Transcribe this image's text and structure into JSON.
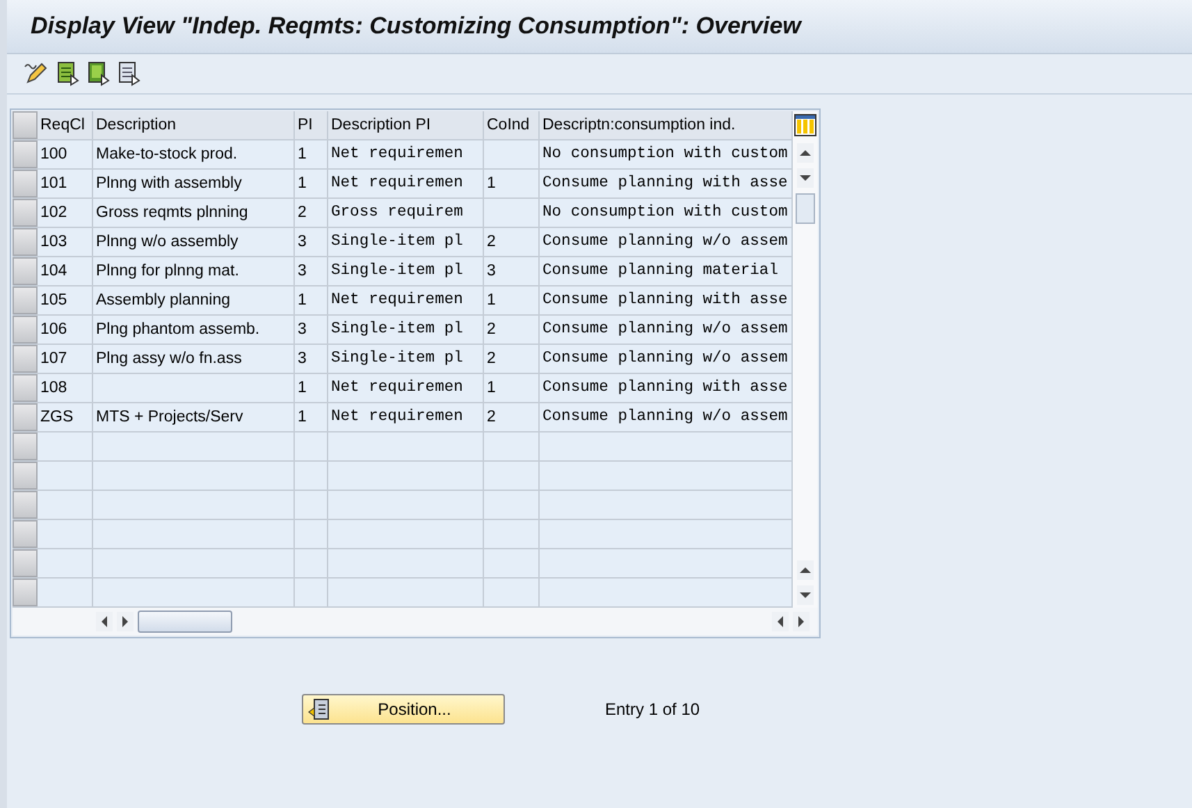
{
  "window": {
    "title": "Display View \"Indep. Reqmts: Customizing Consumption\": Overview"
  },
  "table": {
    "columns": [
      "ReqCl",
      "Description",
      "PI",
      "Description PI",
      "CoInd",
      "Descriptn:consumption ind."
    ],
    "rows": [
      {
        "cells": [
          "100",
          "Make-to-stock prod.",
          "1",
          "Net requiremen",
          "",
          "No consumption with custom"
        ]
      },
      {
        "cells": [
          "101",
          "Plnng with assembly",
          "1",
          "Net requiremen",
          "1",
          "Consume planning with asse"
        ]
      },
      {
        "cells": [
          "102",
          "Gross reqmts plnning",
          "2",
          "Gross requirem",
          "",
          "No consumption with custom"
        ]
      },
      {
        "cells": [
          "103",
          "Plnng w/o assembly",
          "3",
          "Single-item pl",
          "2",
          "Consume planning w/o assem"
        ]
      },
      {
        "cells": [
          "104",
          "Plnng for plnng mat.",
          "3",
          "Single-item pl",
          "3",
          "Consume planning material"
        ]
      },
      {
        "cells": [
          "105",
          "Assembly planning",
          "1",
          "Net requiremen",
          "1",
          "Consume planning with asse"
        ]
      },
      {
        "cells": [
          "106",
          "Plng phantom assemb.",
          "3",
          "Single-item pl",
          "2",
          "Consume planning w/o assem"
        ]
      },
      {
        "cells": [
          "107",
          "Plng assy w/o fn.ass",
          "3",
          "Single-item pl",
          "2",
          "Consume planning w/o assem"
        ]
      },
      {
        "cells": [
          "108",
          "",
          "1",
          "Net requiremen",
          "1",
          "Consume planning with asse"
        ]
      },
      {
        "cells": [
          "ZGS",
          "MTS + Projects/Serv",
          "1",
          "Net requiremen",
          "2",
          "Consume planning w/o assem"
        ]
      }
    ]
  },
  "position_button": {
    "label": "Position..."
  },
  "entry_info": "Entry 1 of 10"
}
